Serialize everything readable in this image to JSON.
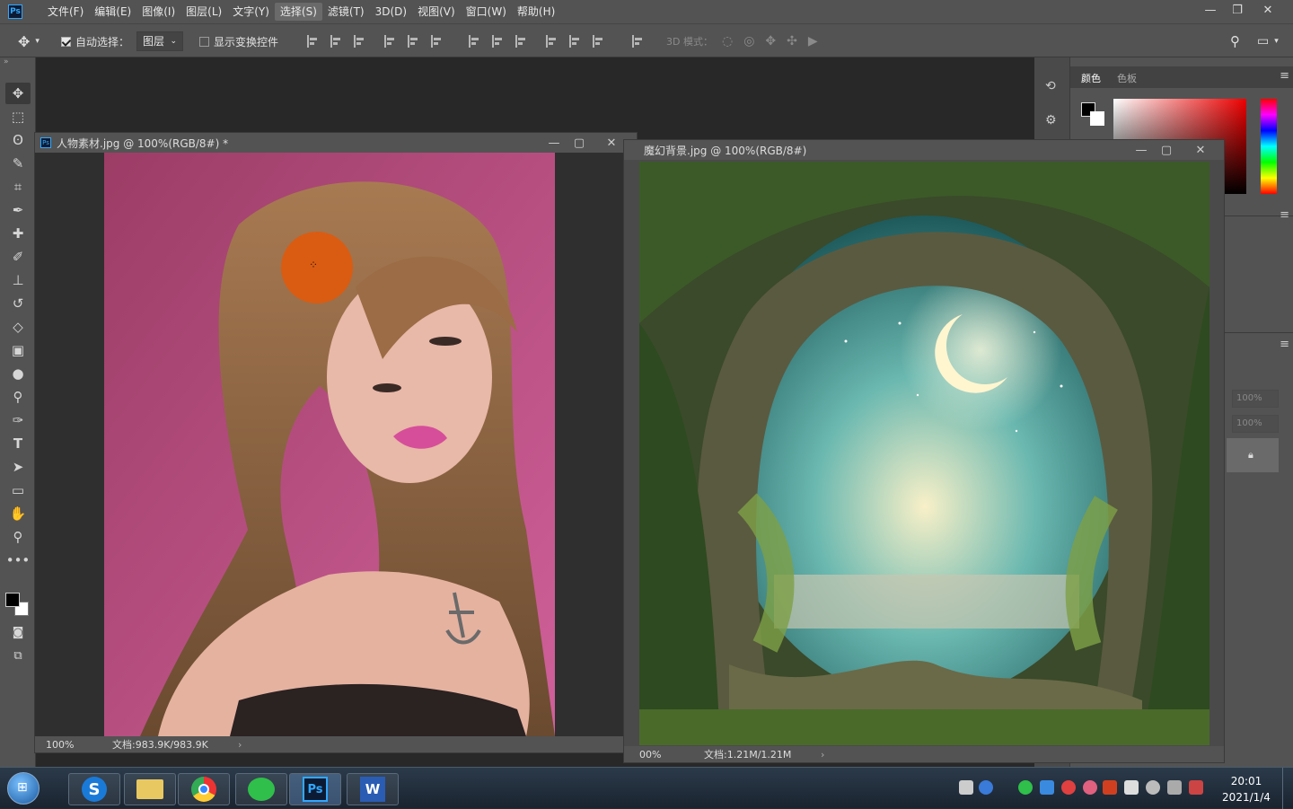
{
  "app": {
    "logo": "Ps"
  },
  "menu": [
    "文件(F)",
    "编辑(E)",
    "图像(I)",
    "图层(L)",
    "文字(Y)",
    "选择(S)",
    "滤镜(T)",
    "3D(D)",
    "视图(V)",
    "窗口(W)",
    "帮助(H)"
  ],
  "menu_active": "选择(S)",
  "window_controls": {
    "minimize": "—",
    "restore": "❐",
    "close": "✕"
  },
  "options": {
    "auto_select_label": "自动选择：",
    "auto_select_target": "图层",
    "show_transform_label": "显示变换控件",
    "mode_3d_label": "3D 模式："
  },
  "panels": {
    "tab_color": "颜色",
    "tab_swatches": "色板",
    "percent_1": "100%",
    "percent_2": "100%"
  },
  "doc1": {
    "title": "人物素材.jpg @ 100%(RGB/8#) *",
    "zoom": "100%",
    "doc_size": "文档:983.9K/983.9K"
  },
  "doc2": {
    "title": "魔幻背景.jpg @ 100%(RGB/8#)",
    "zoom": "00%",
    "doc_size": "文档:1.21M/1.21M"
  },
  "taskbar": {
    "time": "20:01",
    "date": "2021/1/4",
    "apps": [
      "sogou-icon",
      "file-explorer-icon",
      "chrome-icon",
      "wechat-icon",
      "photoshop-icon",
      "word-icon"
    ]
  },
  "colors": {
    "accent": "#31a8ff",
    "pink_bg": "#b84a7c",
    "brush_cursor": "#e05a0c"
  }
}
